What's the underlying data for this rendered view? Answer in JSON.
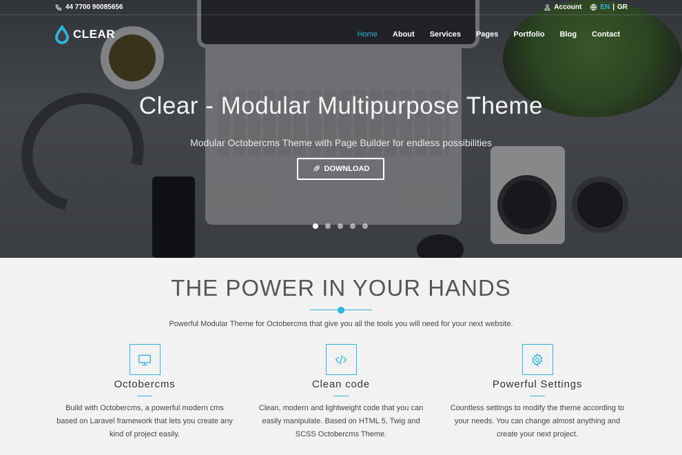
{
  "topbar": {
    "phone": "44 7700 90085656",
    "account": "Account",
    "lang_en": "EN",
    "lang_sep": "|",
    "lang_gr": "GR"
  },
  "logo": {
    "text": "CLEAR"
  },
  "nav": {
    "items": [
      "Home",
      "About",
      "Services",
      "Pages",
      "Portfolio",
      "Blog",
      "Contact"
    ],
    "active": "Home"
  },
  "hero": {
    "title": "Clear - Modular Multipurpose Theme",
    "subtitle": "Modular Octobercms Theme with Page Builder for endless possibilities",
    "button_label": "DOWNLOAD",
    "slides": 5,
    "active_slide": 1
  },
  "section": {
    "title": "THE POWER IN YOUR HANDS",
    "description": "Powerful Modular Theme for Octobercms that give you all the tools you will need for your next website."
  },
  "features": [
    {
      "icon": "monitor-icon",
      "title": "Octobercms",
      "text": "Build with Octobercms, a powerful modern cms based on Laravel framework that lets you create any kind of project easily."
    },
    {
      "icon": "code-icon",
      "title": "Clean code",
      "text": "Clean, modern and lightweight code that you can easily manipulate. Based on HTML 5, Twig and SCSS Octobercms Theme."
    },
    {
      "icon": "gear-icon",
      "title": "Powerful Settings",
      "text": "Countless settings to modify the theme according to your needs. You can change almost anything and create your next project."
    }
  ],
  "colors": {
    "accent": "#2fb3d9",
    "background": "#f2f2f2",
    "text": "#333333"
  }
}
